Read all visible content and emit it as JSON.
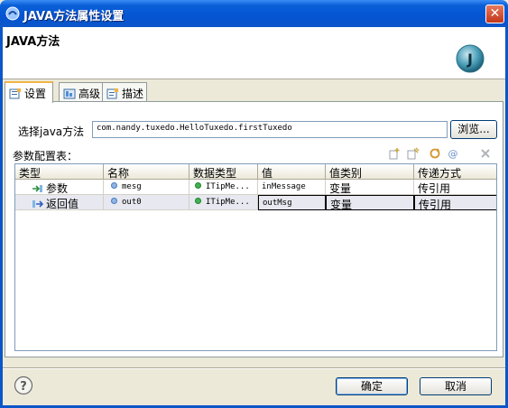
{
  "window": {
    "title": "JAVA方法属性设置",
    "close_glyph": "✕"
  },
  "banner": {
    "heading": "JAVA方法",
    "logo_letter": "J"
  },
  "tabs": [
    {
      "label": "设置",
      "icon": "settings-tab-icon",
      "active": true
    },
    {
      "label": "高级",
      "icon": "advanced-tab-icon",
      "active": false
    },
    {
      "label": "描述",
      "icon": "description-tab-icon",
      "active": false
    }
  ],
  "method": {
    "label": "选择java方法",
    "value": "com.nandy.tuxedo.HelloTuxedo.firstTuxedo",
    "browse_label": "浏览..."
  },
  "params": {
    "label": "参数配置表：",
    "toolbar_icons": [
      "add-param-icon",
      "edit-param-icon",
      "refresh-icon",
      "at-icon",
      "delete-icon"
    ],
    "columns": [
      "类型",
      "名称",
      "数据类型",
      "值",
      "值类别",
      "传递方式"
    ],
    "rows": [
      {
        "type": "参数",
        "name": "mesg",
        "datatype": "ITipMe...",
        "value": "inMessage",
        "value_category": "变量",
        "pass_mode": "传引用"
      },
      {
        "type": "返回值",
        "name": "out0",
        "datatype": "ITipMe...",
        "value": "outMsg",
        "value_category": "变量",
        "pass_mode": "传引用"
      }
    ]
  },
  "footer": {
    "help_glyph": "?",
    "ok_label": "确定",
    "cancel_label": "取消"
  },
  "colors": {
    "titlebar": "#0554d2",
    "window_bg": "#ece9d8",
    "selected_row": "#e7e8f0"
  }
}
